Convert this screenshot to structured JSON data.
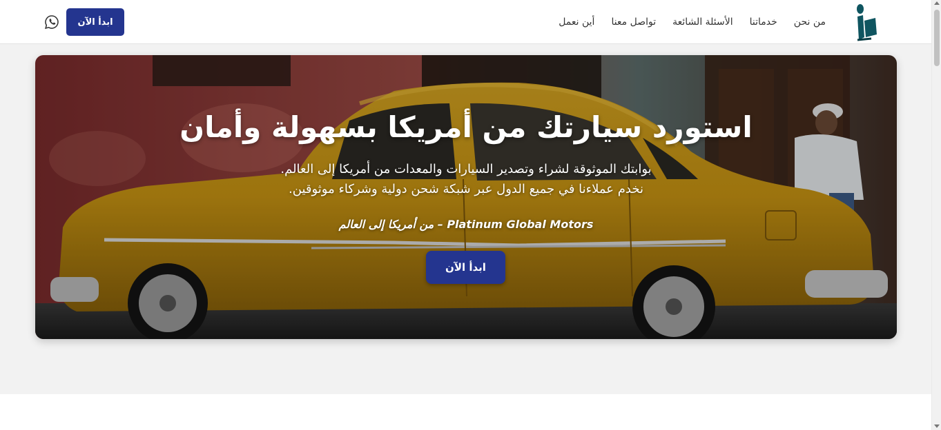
{
  "header": {
    "nav": [
      {
        "label": "من نحن"
      },
      {
        "label": "خدماتنا"
      },
      {
        "label": "الأسئلة الشائعة"
      },
      {
        "label": "تواصل معنا"
      },
      {
        "label": "أين نعمل"
      }
    ],
    "cta_label": "ابدأ الآن",
    "icons": {
      "logo": "brand-logo-icon",
      "whatsapp": "whatsapp-icon"
    }
  },
  "hero": {
    "title": "استورد سيارتك من أمريكا بسهولة وأمان",
    "subtitle_line1": "بوابتك الموثوقة لشراء وتصدير السيارات والمعدات من أمريكا إلى العالم.",
    "subtitle_line2": "نخدم عملاءنا في جميع الدول عبر شبكة شحن دولية وشركاء موثوقين.",
    "tagline": "Platinum Global Motors – من أمريكا إلى العالم",
    "cta_label": "ابدأ الآن"
  },
  "colors": {
    "accent": "#24358f",
    "logo_teal": "#0f5560",
    "header_bg": "#ffffff",
    "page_bg": "#f2f2f2"
  }
}
